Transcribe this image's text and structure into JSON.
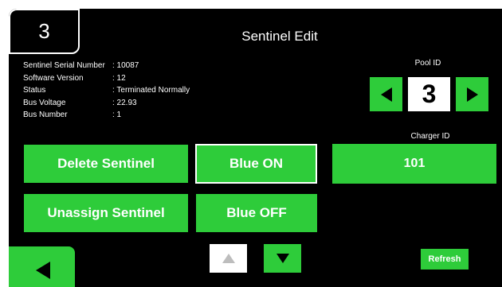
{
  "page": {
    "number": "3",
    "title": "Sentinel Edit"
  },
  "info": [
    {
      "label": "Sentinel Serial Number",
      "value": ": 10087"
    },
    {
      "label": "Software Version",
      "value": ": 12"
    },
    {
      "label": "Status",
      "value": ": Terminated Normally"
    },
    {
      "label": "Bus Voltage",
      "value": ": 22.93"
    },
    {
      "label": "Bus Number",
      "value": ": 1"
    }
  ],
  "pool": {
    "label": "Pool ID",
    "value": "3"
  },
  "charger": {
    "label": "Charger ID",
    "value": "101"
  },
  "buttons": {
    "delete": "Delete Sentinel",
    "unassign": "Unassign Sentinel",
    "blue_on": "Blue ON",
    "blue_off": "Blue OFF",
    "refresh": "Refresh"
  },
  "colors": {
    "accent": "#2ecc3a",
    "background": "#000000",
    "text": "#ffffff"
  }
}
